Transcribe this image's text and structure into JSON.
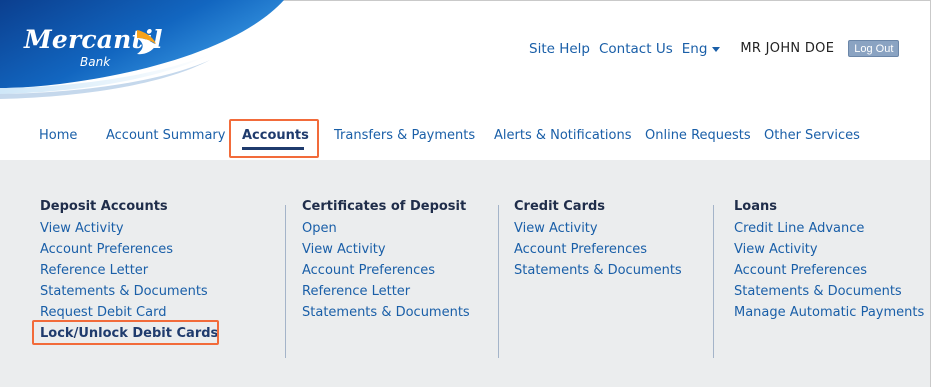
{
  "brand": {
    "name": "Mercantil",
    "sub": "Bank",
    "colors": {
      "primary": "#1a5fa8",
      "dark": "#1f3b6d",
      "accent_orange": "#f7a21b",
      "highlight": "#f26b3a",
      "panel_bg": "#ebedee"
    }
  },
  "header": {
    "site_help": "Site Help",
    "contact_us": "Contact Us",
    "language": "Eng",
    "user_name": "MR JOHN DOE",
    "logout": "Log Out"
  },
  "nav": {
    "items": [
      {
        "label": "Home"
      },
      {
        "label": "Account Summary"
      },
      {
        "label": "Accounts",
        "active": true
      },
      {
        "label": "Transfers & Payments"
      },
      {
        "label": "Alerts & Notifications"
      },
      {
        "label": "Online Requests"
      },
      {
        "label": "Other Services"
      }
    ]
  },
  "menu": {
    "deposit": {
      "title": "Deposit Accounts",
      "links": [
        "View Activity",
        "Account Preferences",
        "Reference Letter",
        "Statements & Documents",
        "Request Debit Card",
        "Lock/Unlock Debit Cards"
      ]
    },
    "cds": {
      "title": "Certificates of Deposit",
      "links": [
        "Open",
        "View Activity",
        "Account Preferences",
        "Reference Letter",
        "Statements & Documents"
      ]
    },
    "credit": {
      "title": "Credit Cards",
      "links": [
        "View Activity",
        "Account Preferences",
        "Statements & Documents"
      ]
    },
    "loans": {
      "title": "Loans",
      "links": [
        "Credit Line Advance",
        "View Activity",
        "Account Preferences",
        "Statements & Documents",
        "Manage Automatic Payments"
      ]
    }
  }
}
